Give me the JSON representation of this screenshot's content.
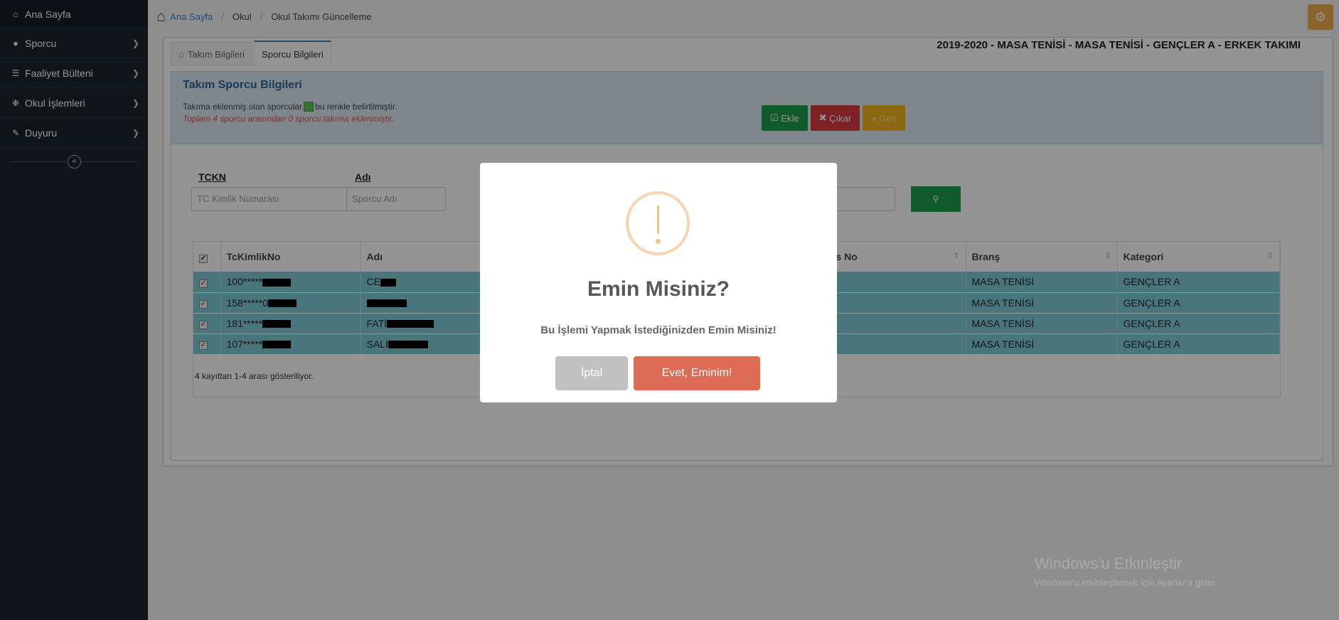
{
  "sidebar": {
    "home": "Ana Sayfa",
    "items": [
      {
        "label": "Sporcu",
        "icon": "users-icon"
      },
      {
        "label": "Faaliyet Bülteni",
        "icon": "list-icon"
      },
      {
        "label": "Okul İşlemleri",
        "icon": "gears-icon"
      },
      {
        "label": "Duyuru",
        "icon": "edit-icon"
      }
    ]
  },
  "breadcrumb": [
    "Ana Sayfa",
    "Okul",
    "Okul Takımı Güncelleme"
  ],
  "tabs": [
    "Takım Bilgileri",
    "Sporcu Bilgileri"
  ],
  "team_title": "2019-2020 - MASA TENİSİ - MASA TENİSİ - GENÇLER A - ERKEK TAKIMI",
  "box": {
    "title": "Takım Sporcu Bilgileri",
    "info_before": "Takıma eklenmiş olan sporcular",
    "info_after": "bu renkle belirtilmiştir.",
    "info_count": "Toplam 4 sporcu arasından 0 sporcu takıma eklenmiştir.",
    "actions": [
      "Ekle",
      "Çıkar",
      "Geri"
    ]
  },
  "filters": {
    "tckn_label": "TCKN",
    "tckn_placeholder": "TC Kimlik Numarası",
    "adi_label": "Adı",
    "adi_placeholder": "Sporcu Adı"
  },
  "table": {
    "headers": [
      "TcKimlikNo",
      "Adı",
      "s No",
      "Branş",
      "Kategori"
    ],
    "rows": [
      {
        "tc": "100*****",
        "adi": "CE",
        "brans": "MASA TENİSİ",
        "kategori": "GENÇLER A"
      },
      {
        "tc": "158*****0",
        "adi": "",
        "brans": "MASA TENİSİ",
        "kategori": "GENÇLER A"
      },
      {
        "tc": "181*****",
        "adi": "FATİ",
        "brans": "MASA TENİSİ",
        "kategori": "GENÇLER A"
      },
      {
        "tc": "107*****",
        "adi": "SALİ",
        "brans": "MASA TENİSİ",
        "kategori": "GENÇLER A"
      }
    ],
    "footer": "4 kayıttan 1-4 arası gösteriliyor."
  },
  "modal": {
    "title": "Emin Misiniz?",
    "text": "Bu İşlemi Yapmak İstediğinizden Emin Misiniz!",
    "cancel": "İptal",
    "confirm": "Evet, Eminim!"
  },
  "watermark": {
    "line1": "Windows'u Etkinleştir",
    "line2": "Windows'u etkinleştirmek için Ayarlar'a gidin."
  },
  "colors": {
    "sidebar": "#1c2529",
    "row_selected": "#7fcbd8",
    "confirm": "#dd6b55",
    "add": "#1a9d4d",
    "remove": "#d83a3f",
    "back": "#f5b31e"
  }
}
